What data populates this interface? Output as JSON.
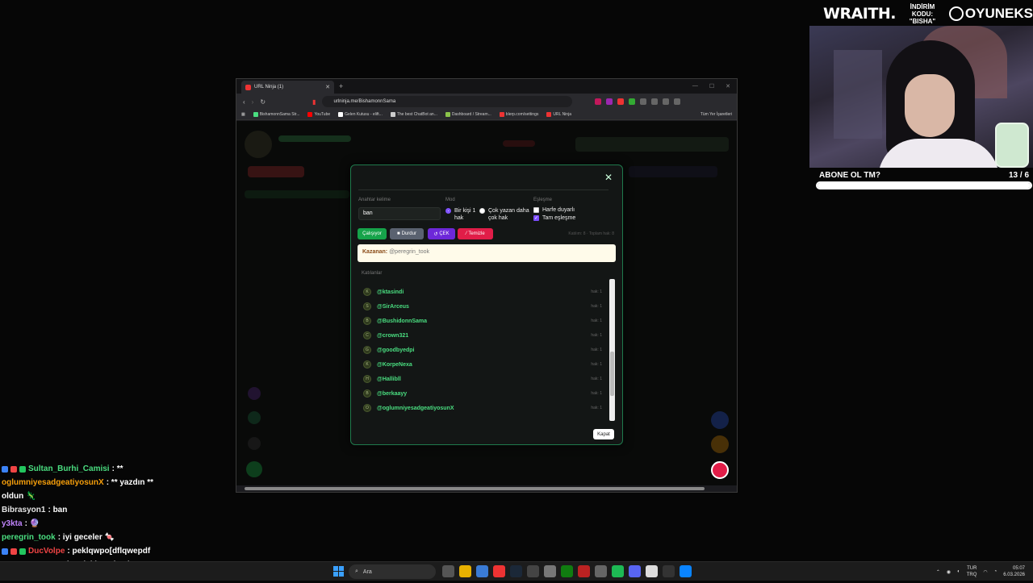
{
  "sponsor": {
    "brand": "WRAITH.",
    "code_line1": "İNDİRİM KODU:",
    "code_line2": "\"BISHA\"",
    "brand2": "OYUNEKS"
  },
  "goal": {
    "title": "ABONE OL TM?",
    "current": "13",
    "separator": "/",
    "target": "6",
    "progress": 1.0
  },
  "browser": {
    "tab_title": "URL Ninja (1)",
    "url": "urlninja.me/BishamonnSama",
    "bookmarks": [
      "BishamonnSama Str...",
      "YouTube",
      "Gelen Kutusu - elift...",
      "The best ChatBot an...",
      "Dashboard / Stream...",
      "blerp.com/settings",
      "URL Ninja"
    ],
    "all_bookmarks": "Tüm Yer İşaretleri"
  },
  "modal": {
    "keyword_label": "Anahtar kelime",
    "keyword_value": "ban",
    "mode_label": "Mod",
    "mode_options": [
      "Bir kişi 1 hak",
      "Çok yazan daha çok hak"
    ],
    "match_label": "Eşleşme",
    "match_options": [
      "Harfe duyarlı",
      "Tam eşleşme"
    ],
    "buttons": {
      "running": "Çalışıyor",
      "stop": "Durdur",
      "draw": "ÇEK",
      "clear": "Temizle"
    },
    "stats": "Katılım: 8 · Toplam hak: 8",
    "winner_label": "Kazanan:",
    "winner_value": "@peregrin_took",
    "participants_label": "Katılanlar",
    "participants": [
      {
        "initial": "K",
        "name": "@ktasindi",
        "hak": "hak: 1"
      },
      {
        "initial": "S",
        "name": "@SirArceus",
        "hak": "hak: 1"
      },
      {
        "initial": "B",
        "name": "@BushidonnSama",
        "hak": "hak: 1"
      },
      {
        "initial": "C",
        "name": "@crown321",
        "hak": "hak: 1"
      },
      {
        "initial": "G",
        "name": "@goodbyedpi",
        "hak": "hak: 1"
      },
      {
        "initial": "K",
        "name": "@KorpeNexa",
        "hak": "hak: 1"
      },
      {
        "initial": "H",
        "name": "@Hallibll",
        "hak": "hak: 1"
      },
      {
        "initial": "B",
        "name": "@berkaayy",
        "hak": "hak: 1"
      },
      {
        "initial": "O",
        "name": "@oglumniyesadgeatiyosunX",
        "hak": "hak: 1"
      }
    ],
    "close_button": "Kapat"
  },
  "chat": [
    {
      "user": "Sultan_Burhi_Camisi",
      "color": "#4ade80",
      "text": ": **"
    },
    {
      "user": "oglumniyesadgeatiyosunX",
      "color": "#f59e0b",
      "text": ": ** yazdın **"
    },
    {
      "user": "",
      "color": "#fff",
      "text": "oldun 🦎"
    },
    {
      "user": "Bibrasyon1",
      "color": "#e5e5e5",
      "text": ": ban"
    },
    {
      "user": "y3kta",
      "color": "#c084fc",
      "text": ": 🔮"
    },
    {
      "user": "peregrin_took",
      "color": "#4ade80",
      "text": ": iyi geceler 🍬"
    },
    {
      "user": "DucVolpe",
      "color": "#ef4444",
      "text": ": peklqwpo[dflqwepdf"
    },
    {
      "user": "KorpeNexa",
      "color": "#e5e5e5",
      "text": ": Benim nickim mi yok"
    }
  ],
  "taskbar": {
    "search_placeholder": "Ara",
    "lang": "TUR",
    "lang2": "TRQ",
    "time": "05:07",
    "date": "6.03.2026"
  }
}
